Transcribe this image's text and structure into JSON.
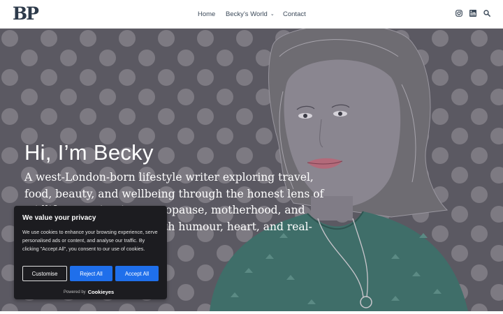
{
  "header": {
    "logo_left": "B",
    "logo_right": "P",
    "nav": [
      {
        "label": "Home"
      },
      {
        "label": "Becky’s World"
      },
      {
        "label": "Contact"
      }
    ],
    "icons": [
      "instagram-icon",
      "linkedin-icon",
      "search-icon"
    ]
  },
  "hero": {
    "title": "Hi, I’m Becky",
    "text": "A west-London-born lifestyle writer exploring travel, food, beauty, and wellbeing through the honest lens of midlife — navigating menopause, motherhood, and everything in between with humour, heart, and real-life"
  },
  "cookie": {
    "title": "We value your privacy",
    "body": "We use cookies to enhance your browsing experience, serve personalised ads or content, and analyse our traffic. By clicking \"Accept All\", you consent to our use of cookies.",
    "customise": "Customise",
    "reject": "Reject All",
    "accept": "Accept All",
    "powered_by": "Powered by",
    "brand": "Cookieyes"
  },
  "colors": {
    "hero_bg": "#5b5962",
    "dot": "#7d7a82",
    "accept_blue": "#1f6feb",
    "banner_bg": "#1c1c20",
    "sweater": "#3f6e69"
  }
}
